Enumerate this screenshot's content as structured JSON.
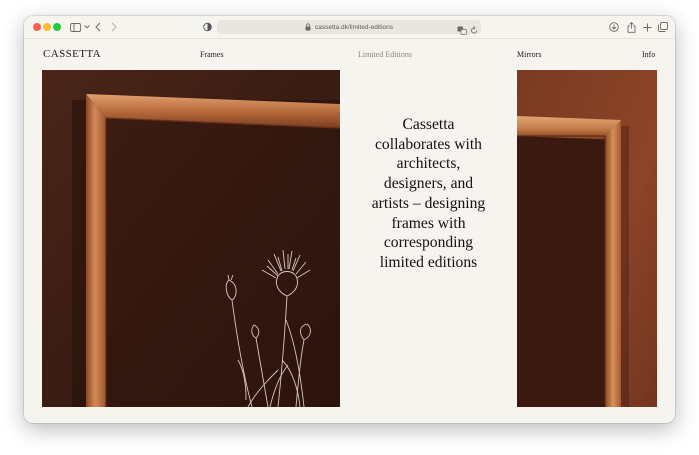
{
  "browser": {
    "url": "cassetta.dk/limited-editions"
  },
  "site": {
    "logo": "CASSETTA",
    "nav": {
      "frames": "Frames",
      "limited_editions": "Limited Editions",
      "mirrors": "Mirrors",
      "info": "Info"
    },
    "headline": "Cassetta collaborates with architects, designers, and artists – designing frames with corresponding limited editions"
  },
  "colors": {
    "page_bg": "#f6f4ef",
    "text": "#1d1b18",
    "active_nav": "#8a877f",
    "wall_dark": "#3a1d14",
    "wood": "#b86a3e"
  },
  "icons": {
    "toolbar": [
      "sidebar-icon",
      "chevron-down-icon",
      "back-icon",
      "forward-icon",
      "shield-icon",
      "lock-icon",
      "translate-icon",
      "reload-icon",
      "download-icon",
      "share-icon",
      "new-tab-icon",
      "tabs-overview-icon"
    ]
  }
}
